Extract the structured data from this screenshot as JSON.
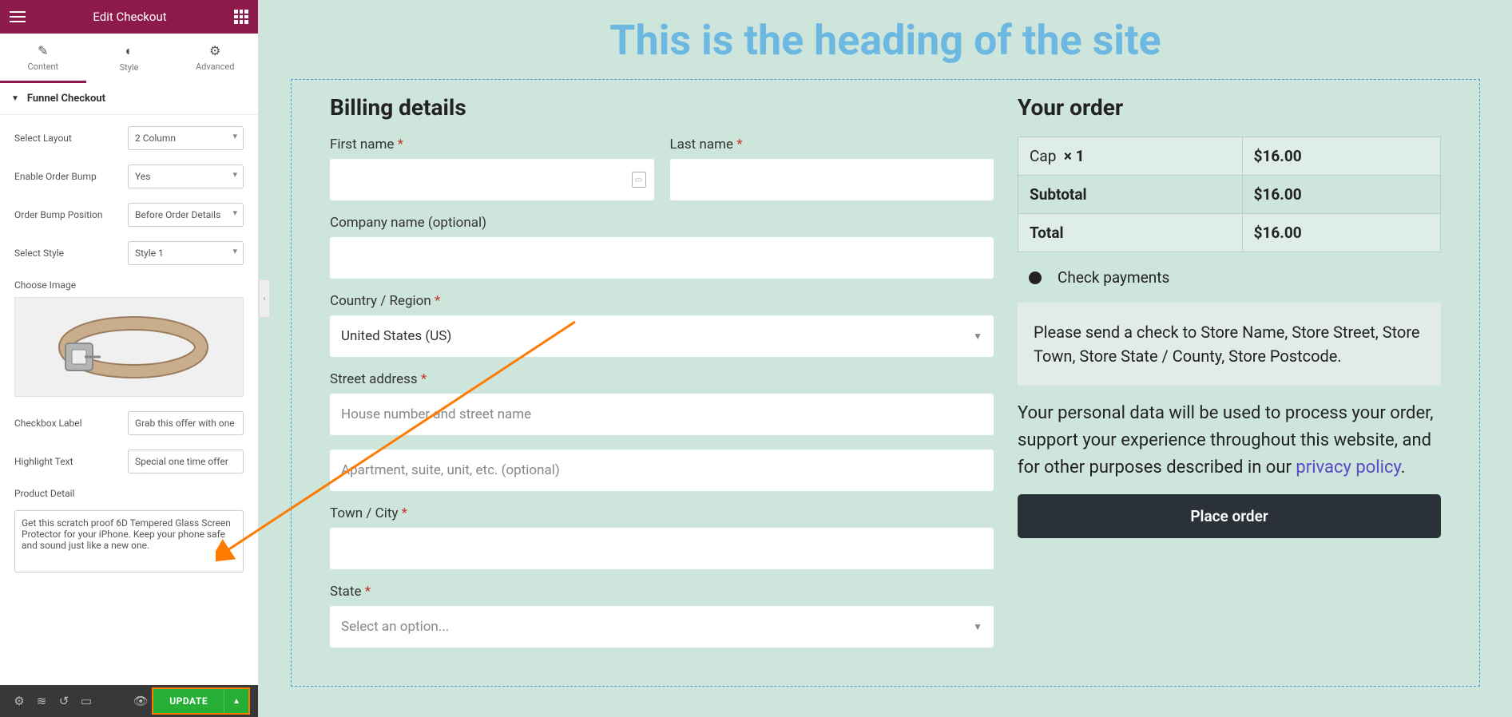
{
  "panel": {
    "title": "Edit Checkout",
    "tabs": {
      "content": "Content",
      "style": "Style",
      "advanced": "Advanced"
    },
    "section": "Funnel Checkout",
    "fields": {
      "select_layout_label": "Select Layout",
      "select_layout_value": "2 Column",
      "enable_order_bump_label": "Enable Order Bump",
      "enable_order_bump_value": "Yes",
      "order_bump_position_label": "Order Bump Position",
      "order_bump_position_value": "Before Order Details",
      "select_style_label": "Select Style",
      "select_style_value": "Style 1",
      "choose_image_label": "Choose Image",
      "checkbox_label_label": "Checkbox Label",
      "checkbox_label_value": "Grab this offer with one click",
      "highlight_text_label": "Highlight Text",
      "highlight_text_value": "Special one time offer",
      "product_detail_label": "Product Detail",
      "product_detail_value": "Get this scratch proof 6D Tempered Glass Screen Protector for your iPhone. Keep your phone safe and sound just like a new one."
    },
    "footer": {
      "update": "UPDATE"
    }
  },
  "preview": {
    "heading": "This is the heading of the site",
    "billing": {
      "title": "Billing details",
      "first_name": "First name",
      "last_name": "Last name",
      "company": "Company name (optional)",
      "country": "Country / Region",
      "country_value": "United States (US)",
      "street": "Street address",
      "street_ph1": "House number and street name",
      "street_ph2": "Apartment, suite, unit, etc. (optional)",
      "town": "Town / City",
      "state": "State",
      "state_ph": "Select an option..."
    },
    "order": {
      "title": "Your order",
      "item_name": "Cap",
      "item_qty": "× 1",
      "item_price": "$16.00",
      "subtotal_label": "Subtotal",
      "subtotal_value": "$16.00",
      "total_label": "Total",
      "total_value": "$16.00",
      "payment_method": "Check payments",
      "info": "Please send a check to Store Name, Store Street, Store Town, Store State / County, Store Postcode.",
      "privacy_pre": "Your personal data will be used to process your order, support your experience throughout this website, and for other purposes described in our ",
      "privacy_link": "privacy policy",
      "privacy_post": ".",
      "place_order": "Place order"
    }
  }
}
